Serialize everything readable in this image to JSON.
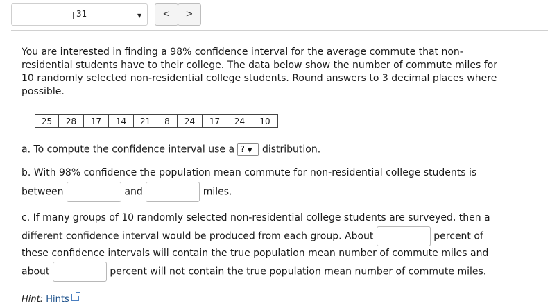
{
  "nav": {
    "question_number": "31",
    "dropdown_caret": "▼",
    "prev_label": "<",
    "next_label": ">"
  },
  "intro": "You are interested in finding a 98% confidence interval for the average commute that non-residential students have to their college. The data below show the number of commute miles for 10 randomly selected non-residential college students. Round answers to 3 decimal places where possible.",
  "data_values": [
    "25",
    "28",
    "17",
    "14",
    "21",
    "8",
    "24",
    "17",
    "24",
    "10"
  ],
  "part_a": {
    "prefix": "a. To compute the confidence interval use a",
    "select_value": "?",
    "suffix": "distribution."
  },
  "part_b": {
    "line1": "b. With 98% confidence the population mean commute for non-residential college students is",
    "between": "between",
    "and": "and",
    "miles": "miles."
  },
  "part_c": {
    "line1": "c. If many groups of 10 randomly selected non-residential college students are surveyed, then a",
    "line2_prefix": "different confidence interval would be produced from each group. About",
    "line2_suffix": "percent of",
    "line3": "these confidence intervals will contain the true population mean number of commute miles and",
    "line4_prefix": "about",
    "line4_suffix": "percent will not contain the true population mean number of  commute miles."
  },
  "hint": {
    "label": "Hint:",
    "link": "Hints"
  }
}
